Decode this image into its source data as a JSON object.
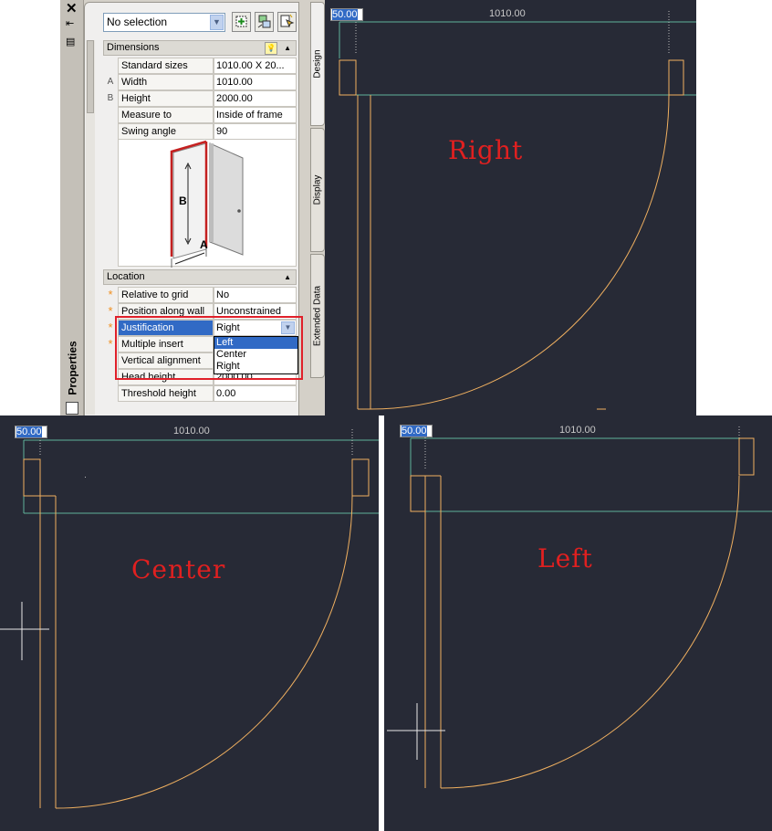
{
  "palette": {
    "title": "Properties",
    "selection_value": "No selection",
    "tabs": [
      "Design",
      "Display",
      "Extended Data"
    ],
    "sections": {
      "dimensions": {
        "label": "Dimensions",
        "rows": [
          {
            "marker": "",
            "name": "Standard sizes",
            "value": "1010.00  X  20..."
          },
          {
            "marker": "A",
            "name": "Width",
            "value": "1010.00"
          },
          {
            "marker": "B",
            "name": "Height",
            "value": "2000.00"
          },
          {
            "marker": "",
            "name": "Measure to",
            "value": "Inside of frame"
          },
          {
            "marker": "",
            "name": "Swing angle",
            "value": "90"
          }
        ],
        "diagram_labels": {
          "a": "A",
          "b": "B"
        }
      },
      "location": {
        "label": "Location",
        "rows": [
          {
            "marker": "*",
            "name": "Relative to grid",
            "value": "No"
          },
          {
            "marker": "*",
            "name": "Position along wall",
            "value": "Unconstrained"
          },
          {
            "marker": "*",
            "name": "Justification",
            "value": "Right"
          },
          {
            "marker": "*",
            "name": "Multiple insert",
            "value": ""
          },
          {
            "marker": "",
            "name": "Vertical alignment",
            "value": ""
          },
          {
            "marker": "",
            "name": "Head height",
            "value": "2000.00"
          },
          {
            "marker": "",
            "name": "Threshold height",
            "value": "0.00"
          }
        ]
      }
    },
    "justification_options": [
      "Left",
      "Center",
      "Right"
    ],
    "justification_highlighted": "Left"
  },
  "viewports": {
    "right": {
      "label": "Right",
      "dim_input": "50.00",
      "dim_text": "1010.00"
    },
    "center": {
      "label": "Center",
      "dim_input": "50.00",
      "dim_text": "1010.00"
    },
    "left": {
      "label": "Left",
      "dim_input": "50.00",
      "dim_text": "1010.00"
    }
  },
  "colors": {
    "canvas_bg": "#272a36",
    "door_line": "#f0b060",
    "wall_line": "#5fb39a",
    "frame_red": "#c0442a",
    "annotation_red": "#e02020",
    "highlight_box": "#e0202a"
  },
  "icons": [
    "close-icon",
    "auto-hide-icon",
    "properties-menu-icon",
    "add-icon",
    "quick-select-icon",
    "pick-objects-icon",
    "lightbulb-icon",
    "collapse-arrow-icon",
    "dropdown-arrow-icon"
  ]
}
